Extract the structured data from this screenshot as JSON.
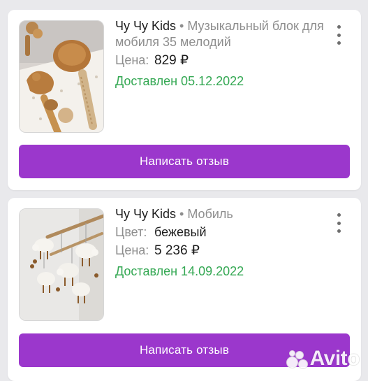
{
  "colors": {
    "accent": "#9b37cc",
    "delivered": "#34a853",
    "label": "#8e8e8e",
    "text": "#1d1d1d",
    "background": "#e9e9ec"
  },
  "orders": [
    {
      "brand": "Чу Чу Kids",
      "separator": "•",
      "name": "Музыкальный блок для мобиля 35 мелодий",
      "price_label": "Цена:",
      "price": "829 ₽",
      "status": "Доставлен 05.12.2022",
      "review_button": "Написать отзыв",
      "menu_icon": "more-vertical-icon"
    },
    {
      "brand": "Чу Чу Kids",
      "separator": "•",
      "name": "Мобиль",
      "color_label": "Цвет:",
      "color": "бежевый",
      "price_label": "Цена:",
      "price": "5 236 ₽",
      "status": "Доставлен 14.09.2022",
      "review_button": "Написать отзыв",
      "menu_icon": "more-vertical-icon"
    }
  ],
  "watermark": {
    "text": "Avito"
  }
}
